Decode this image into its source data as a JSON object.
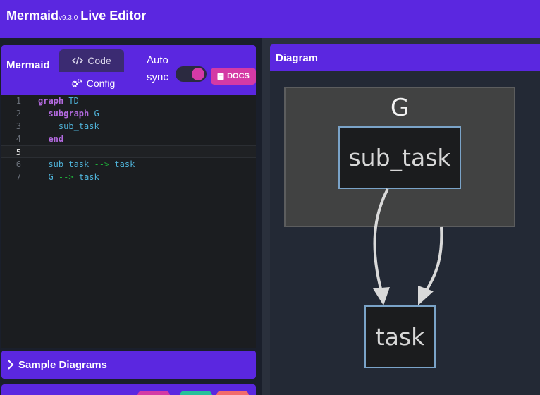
{
  "app": {
    "name": "Mermaid",
    "version": "v9.3.0",
    "subtitle": "Live Editor"
  },
  "editor_panel": {
    "title": "Mermaid",
    "tabs": [
      {
        "label": "Code",
        "icon": "code-icon"
      },
      {
        "label": "Config",
        "icon": "gears-icon"
      }
    ],
    "autosync": {
      "line1": "Auto",
      "line2": "sync",
      "enabled": true
    },
    "docs_label": "DOCS"
  },
  "code_lines": [
    {
      "n": "1",
      "tokens": [
        [
          "kw",
          "graph"
        ],
        [
          "sp",
          " "
        ],
        [
          "id",
          "TD"
        ]
      ]
    },
    {
      "n": "2",
      "tokens": [
        [
          "sp",
          "  "
        ],
        [
          "kw",
          "subgraph"
        ],
        [
          "sp",
          " "
        ],
        [
          "id",
          "G"
        ]
      ]
    },
    {
      "n": "3",
      "tokens": [
        [
          "sp",
          "    "
        ],
        [
          "id",
          "sub_task"
        ]
      ]
    },
    {
      "n": "4",
      "tokens": [
        [
          "sp",
          "  "
        ],
        [
          "kw",
          "end"
        ]
      ]
    },
    {
      "n": "5",
      "tokens": []
    },
    {
      "n": "6",
      "tokens": [
        [
          "sp",
          "  "
        ],
        [
          "id",
          "sub_task"
        ],
        [
          "sp",
          " "
        ],
        [
          "ar",
          "-->"
        ],
        [
          "sp",
          " "
        ],
        [
          "id",
          "task"
        ]
      ]
    },
    {
      "n": "7",
      "tokens": [
        [
          "sp",
          "  "
        ],
        [
          "id",
          "G"
        ],
        [
          "sp",
          " "
        ],
        [
          "ar",
          "-->"
        ],
        [
          "sp",
          " "
        ],
        [
          "id",
          "task"
        ]
      ]
    }
  ],
  "sample_diagrams_label": "Sample Diagrams",
  "diagram_panel": {
    "title": "Diagram",
    "cluster_label": "G",
    "nodes": {
      "sub_task": "sub_task",
      "task": "task"
    }
  },
  "colors": {
    "brand": "#5b27e0",
    "docs": "#d43aa5",
    "keyword": "#b36adf",
    "arrow": "#1fae3a",
    "identifier": "#4fb3d9",
    "node_border": "#7aa3c8"
  }
}
